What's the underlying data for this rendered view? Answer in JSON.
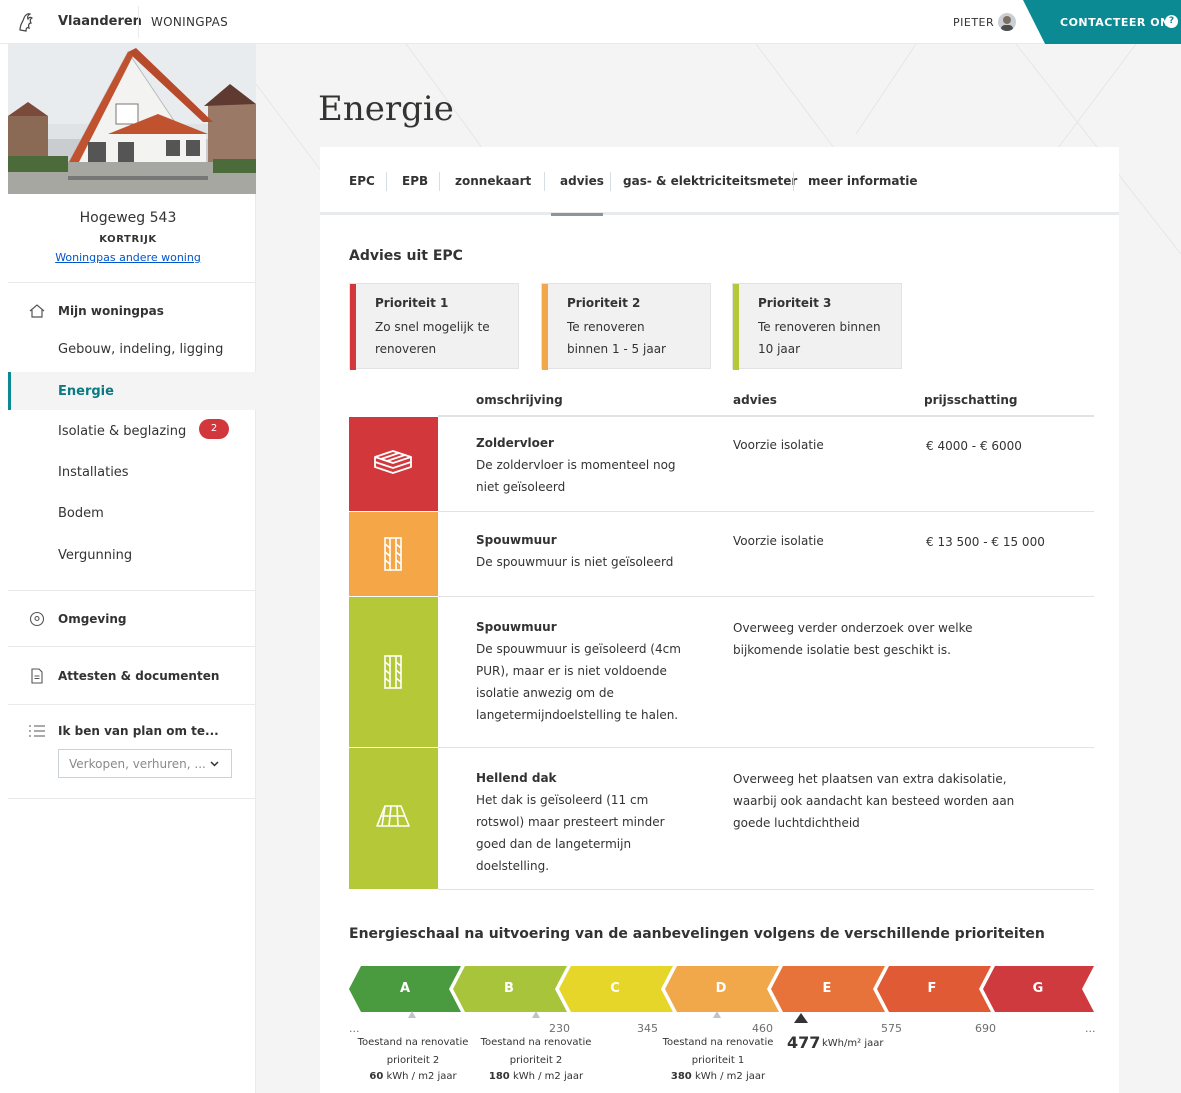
{
  "header": {
    "brand": "Vlaanderen",
    "app_name": "WONINGPAS",
    "user": "PIETER",
    "contact_label": "CONTACTEER ONS",
    "help_glyph": "?"
  },
  "property": {
    "street": "Hogeweg 543",
    "city": "KORTRIJK",
    "other_link": "Woningpas andere woning"
  },
  "sidebar": {
    "home_label": "Mijn woningpas",
    "items": [
      {
        "label": "Gebouw, indeling, ligging"
      },
      {
        "label": "Energie"
      },
      {
        "label": "Isolatie & beglazing"
      },
      {
        "label": "Installaties",
        "badge": "2"
      },
      {
        "label": "Bodem"
      },
      {
        "label": "Vergunning"
      }
    ],
    "surroundings_label": "Omgeving",
    "documents_label": "Attesten & documenten",
    "plans_label": "Ik ben van plan om te...",
    "plans_placeholder": "Verkopen, verhuren, ..."
  },
  "page": {
    "title": "Energie",
    "tabs": [
      "EPC",
      "EPB",
      "zonnekaart",
      "advies",
      "gas- & elektriciteitsmeter",
      "meer informatie"
    ],
    "active_tab": "advies"
  },
  "advice": {
    "section_title": "Advies uit EPC",
    "priorities": [
      {
        "title": "Prioriteit 1",
        "desc": "Zo snel mogelijk te renoveren",
        "color": "#d2373c"
      },
      {
        "title": "Prioriteit 2",
        "desc": "Te renoveren binnen 1 - 5 jaar",
        "color": "#f2a74b"
      },
      {
        "title": "Prioriteit 3",
        "desc": "Te renoveren binnen 10 jaar",
        "color": "#b5c938"
      }
    ],
    "columns": {
      "description": "omschrijving",
      "advice": "advies",
      "price": "prijsschatting"
    },
    "rows": [
      {
        "title": "Zoldervloer",
        "desc": "De zoldervloer is momenteel nog niet geïsoleerd",
        "advice": "Voorzie isolatie",
        "price": "€ 4000 - € 6000",
        "icon": "floor-insulation-icon",
        "color": "#d2373c"
      },
      {
        "title": "Spouwmuur",
        "desc": "De spouwmuur is niet geïsoleerd",
        "advice": "Voorzie isolatie",
        "price": "€ 13 500 - € 15 000",
        "icon": "cavity-wall-icon",
        "color": "#f5a748"
      },
      {
        "title": "Spouwmuur",
        "desc": "De spouwmuur is geïsoleerd (4cm PUR), maar er is niet voldoende isolatie anwezig om de langetermijndoelstelling te halen.",
        "advice": "Overweeg verder onderzoek over welke bijkomende isolatie best geschikt is.",
        "price": "",
        "icon": "cavity-wall-icon",
        "color": "#b5c938"
      },
      {
        "title": "Hellend dak",
        "desc": "Het dak is geïsoleerd (11 cm rotswol) maar presteert minder goed dan de langetermijn doelstelling.",
        "advice": "Overweeg het plaatsen van extra dakisolatie, waarbij ook aandacht kan besteed worden aan goede luchtdichtheid",
        "price": "",
        "icon": "pitched-roof-icon",
        "color": "#b5c938"
      }
    ]
  },
  "energy_scale": {
    "title": "Energieschaal na uitvoering van de aanbevelingen volgens de verschillende prioriteiten",
    "classes": [
      {
        "label": "A",
        "color": "#4a9a3f"
      },
      {
        "label": "B",
        "color": "#a8c43a"
      },
      {
        "label": "C",
        "color": "#e6d62a"
      },
      {
        "label": "D",
        "color": "#f0a84a"
      },
      {
        "label": "E",
        "color": "#e8733a"
      },
      {
        "label": "F",
        "color": "#e05a35"
      },
      {
        "label": "G",
        "color": "#cf3a3e"
      }
    ],
    "ticks": [
      "...",
      "230",
      "345",
      "460",
      "575",
      "690",
      "..."
    ],
    "renovations": [
      {
        "label": "Toestand na renovatie prioriteit 2",
        "value": "60",
        "unit": "kWh / m2 jaar"
      },
      {
        "label": "Toestand na renovatie prioriteit 2",
        "value": "180",
        "unit": "kWh / m2 jaar"
      },
      {
        "label": "Toestand na renovatie prioriteit 1",
        "value": "380",
        "unit": "kWh / m2 jaar"
      }
    ],
    "current_value": "477",
    "current_unit": "kWh/m² jaar"
  }
}
